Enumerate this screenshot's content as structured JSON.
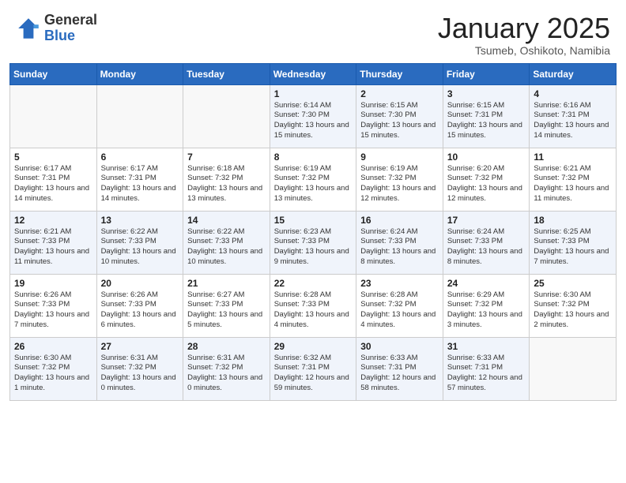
{
  "header": {
    "logo_general": "General",
    "logo_blue": "Blue",
    "month_title": "January 2025",
    "location": "Tsumeb, Oshikoto, Namibia"
  },
  "days_of_week": [
    "Sunday",
    "Monday",
    "Tuesday",
    "Wednesday",
    "Thursday",
    "Friday",
    "Saturday"
  ],
  "weeks": [
    [
      {
        "day": "",
        "info": ""
      },
      {
        "day": "",
        "info": ""
      },
      {
        "day": "",
        "info": ""
      },
      {
        "day": "1",
        "info": "Sunrise: 6:14 AM\nSunset: 7:30 PM\nDaylight: 13 hours\nand 15 minutes."
      },
      {
        "day": "2",
        "info": "Sunrise: 6:15 AM\nSunset: 7:30 PM\nDaylight: 13 hours\nand 15 minutes."
      },
      {
        "day": "3",
        "info": "Sunrise: 6:15 AM\nSunset: 7:31 PM\nDaylight: 13 hours\nand 15 minutes."
      },
      {
        "day": "4",
        "info": "Sunrise: 6:16 AM\nSunset: 7:31 PM\nDaylight: 13 hours\nand 14 minutes."
      }
    ],
    [
      {
        "day": "5",
        "info": "Sunrise: 6:17 AM\nSunset: 7:31 PM\nDaylight: 13 hours\nand 14 minutes."
      },
      {
        "day": "6",
        "info": "Sunrise: 6:17 AM\nSunset: 7:31 PM\nDaylight: 13 hours\nand 14 minutes."
      },
      {
        "day": "7",
        "info": "Sunrise: 6:18 AM\nSunset: 7:32 PM\nDaylight: 13 hours\nand 13 minutes."
      },
      {
        "day": "8",
        "info": "Sunrise: 6:19 AM\nSunset: 7:32 PM\nDaylight: 13 hours\nand 13 minutes."
      },
      {
        "day": "9",
        "info": "Sunrise: 6:19 AM\nSunset: 7:32 PM\nDaylight: 13 hours\nand 12 minutes."
      },
      {
        "day": "10",
        "info": "Sunrise: 6:20 AM\nSunset: 7:32 PM\nDaylight: 13 hours\nand 12 minutes."
      },
      {
        "day": "11",
        "info": "Sunrise: 6:21 AM\nSunset: 7:32 PM\nDaylight: 13 hours\nand 11 minutes."
      }
    ],
    [
      {
        "day": "12",
        "info": "Sunrise: 6:21 AM\nSunset: 7:33 PM\nDaylight: 13 hours\nand 11 minutes."
      },
      {
        "day": "13",
        "info": "Sunrise: 6:22 AM\nSunset: 7:33 PM\nDaylight: 13 hours\nand 10 minutes."
      },
      {
        "day": "14",
        "info": "Sunrise: 6:22 AM\nSunset: 7:33 PM\nDaylight: 13 hours\nand 10 minutes."
      },
      {
        "day": "15",
        "info": "Sunrise: 6:23 AM\nSunset: 7:33 PM\nDaylight: 13 hours\nand 9 minutes."
      },
      {
        "day": "16",
        "info": "Sunrise: 6:24 AM\nSunset: 7:33 PM\nDaylight: 13 hours\nand 8 minutes."
      },
      {
        "day": "17",
        "info": "Sunrise: 6:24 AM\nSunset: 7:33 PM\nDaylight: 13 hours\nand 8 minutes."
      },
      {
        "day": "18",
        "info": "Sunrise: 6:25 AM\nSunset: 7:33 PM\nDaylight: 13 hours\nand 7 minutes."
      }
    ],
    [
      {
        "day": "19",
        "info": "Sunrise: 6:26 AM\nSunset: 7:33 PM\nDaylight: 13 hours\nand 7 minutes."
      },
      {
        "day": "20",
        "info": "Sunrise: 6:26 AM\nSunset: 7:33 PM\nDaylight: 13 hours\nand 6 minutes."
      },
      {
        "day": "21",
        "info": "Sunrise: 6:27 AM\nSunset: 7:33 PM\nDaylight: 13 hours\nand 5 minutes."
      },
      {
        "day": "22",
        "info": "Sunrise: 6:28 AM\nSunset: 7:33 PM\nDaylight: 13 hours\nand 4 minutes."
      },
      {
        "day": "23",
        "info": "Sunrise: 6:28 AM\nSunset: 7:32 PM\nDaylight: 13 hours\nand 4 minutes."
      },
      {
        "day": "24",
        "info": "Sunrise: 6:29 AM\nSunset: 7:32 PM\nDaylight: 13 hours\nand 3 minutes."
      },
      {
        "day": "25",
        "info": "Sunrise: 6:30 AM\nSunset: 7:32 PM\nDaylight: 13 hours\nand 2 minutes."
      }
    ],
    [
      {
        "day": "26",
        "info": "Sunrise: 6:30 AM\nSunset: 7:32 PM\nDaylight: 13 hours\nand 1 minute."
      },
      {
        "day": "27",
        "info": "Sunrise: 6:31 AM\nSunset: 7:32 PM\nDaylight: 13 hours\nand 0 minutes."
      },
      {
        "day": "28",
        "info": "Sunrise: 6:31 AM\nSunset: 7:32 PM\nDaylight: 13 hours\nand 0 minutes."
      },
      {
        "day": "29",
        "info": "Sunrise: 6:32 AM\nSunset: 7:31 PM\nDaylight: 12 hours\nand 59 minutes."
      },
      {
        "day": "30",
        "info": "Sunrise: 6:33 AM\nSunset: 7:31 PM\nDaylight: 12 hours\nand 58 minutes."
      },
      {
        "day": "31",
        "info": "Sunrise: 6:33 AM\nSunset: 7:31 PM\nDaylight: 12 hours\nand 57 minutes."
      },
      {
        "day": "",
        "info": ""
      }
    ]
  ]
}
